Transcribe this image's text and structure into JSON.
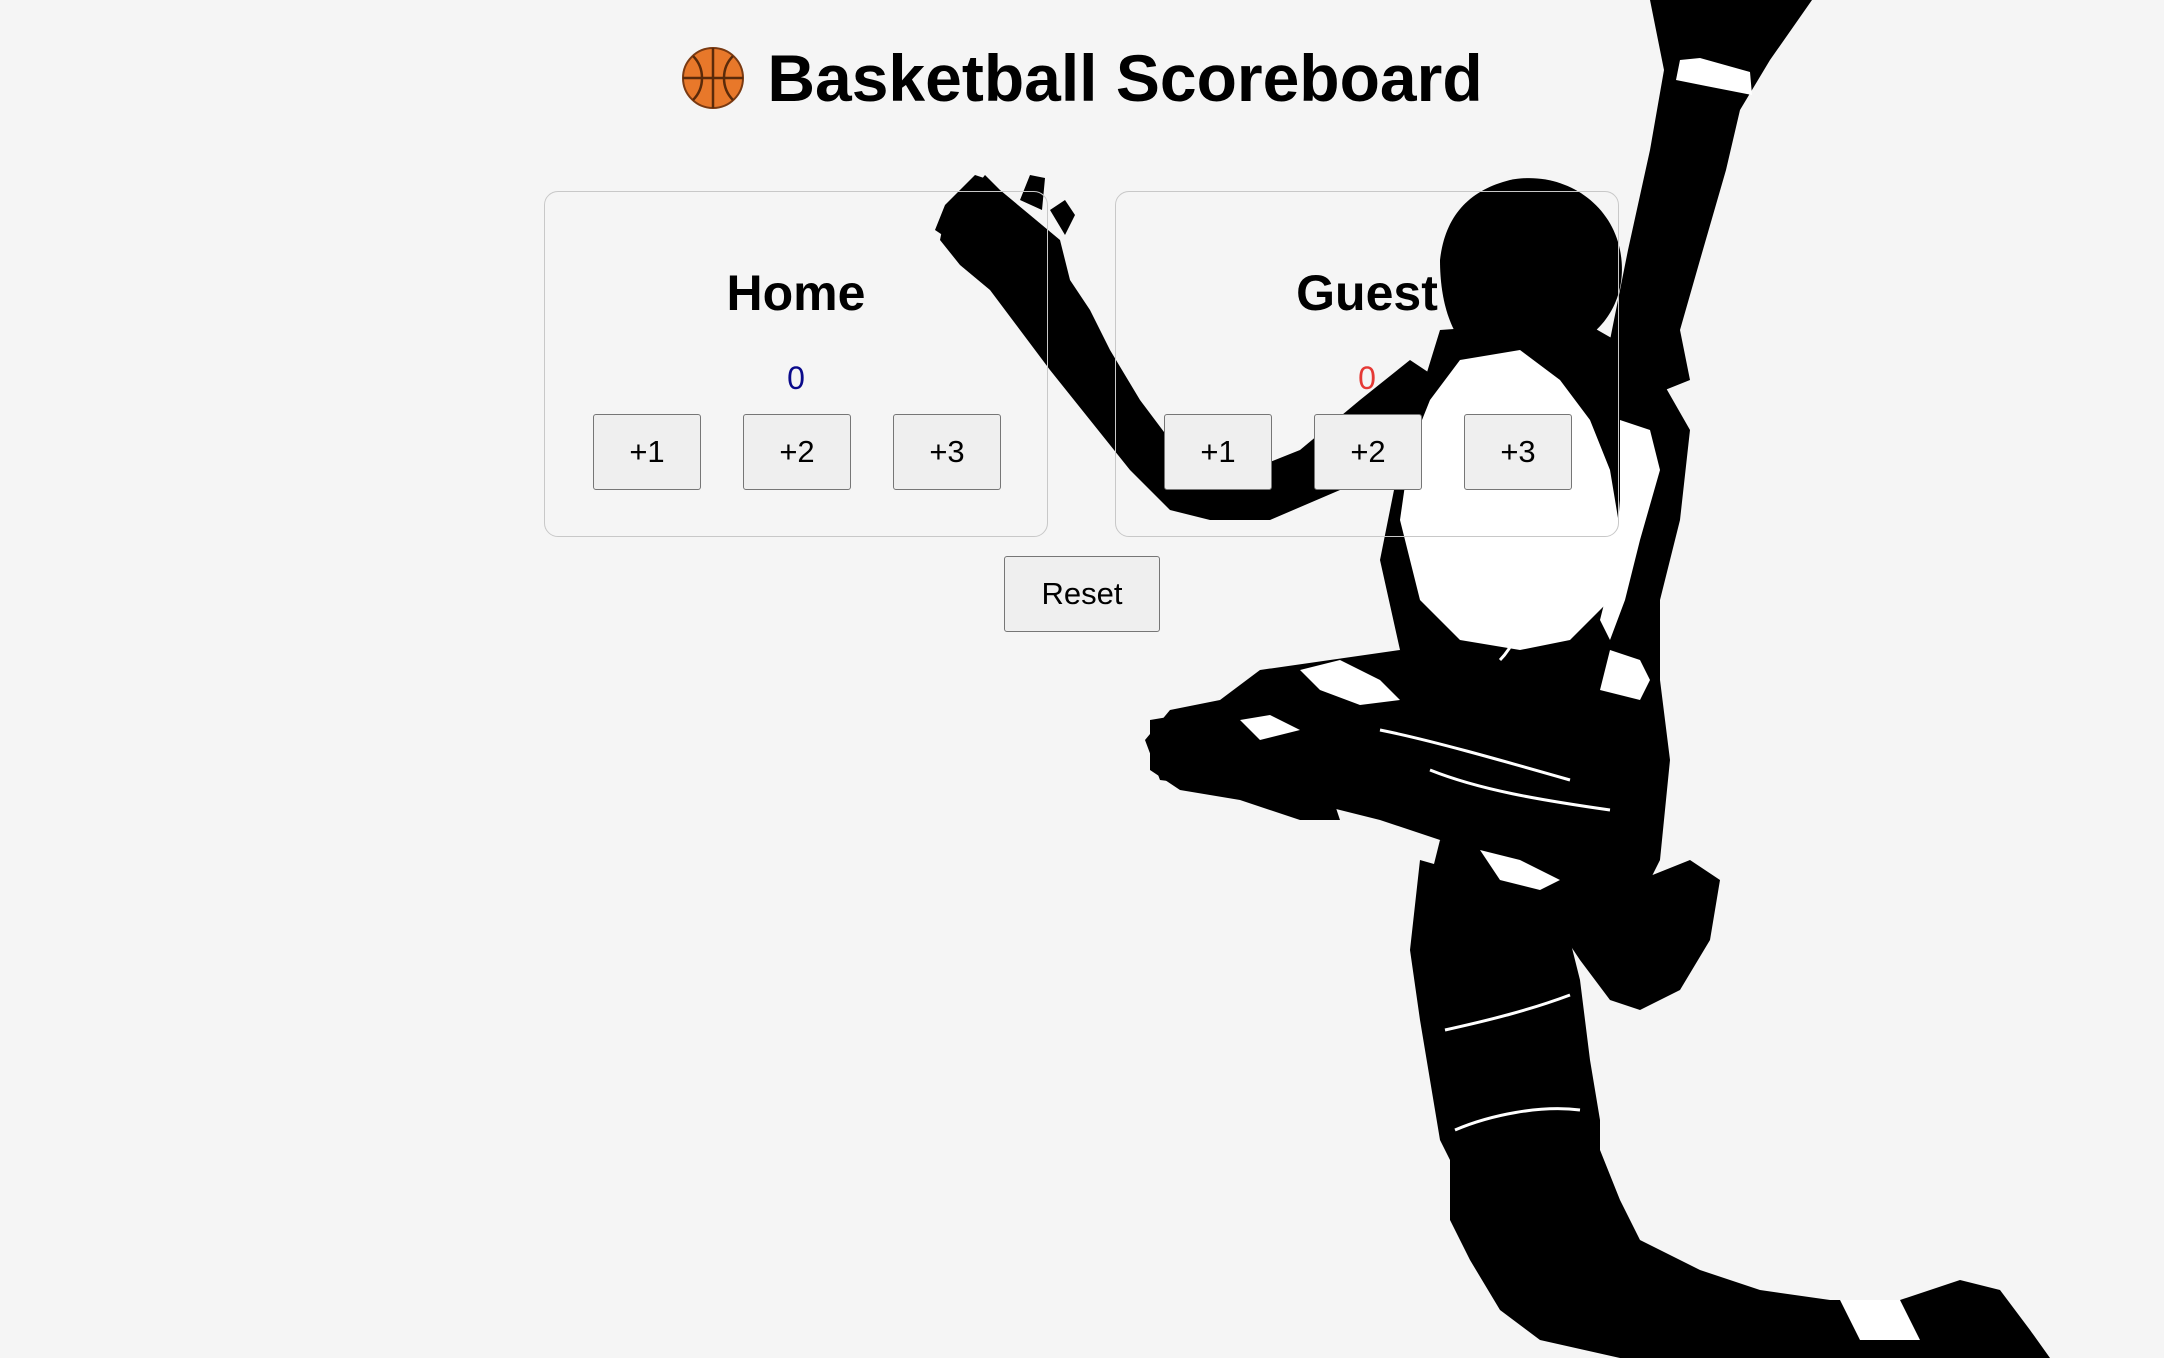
{
  "header": {
    "icon": "basketball-icon",
    "title": "Basketball Scoreboard"
  },
  "teams": [
    {
      "name": "Home",
      "score": "0",
      "score_color": "#0a0a8a",
      "buttons": [
        "+1",
        "+2",
        "+3"
      ]
    },
    {
      "name": "Guest",
      "score": "0",
      "score_color": "#e53935",
      "buttons": [
        "+1",
        "+2",
        "+3"
      ]
    }
  ],
  "reset_label": "Reset",
  "background_image": "basketball-player-silhouette"
}
